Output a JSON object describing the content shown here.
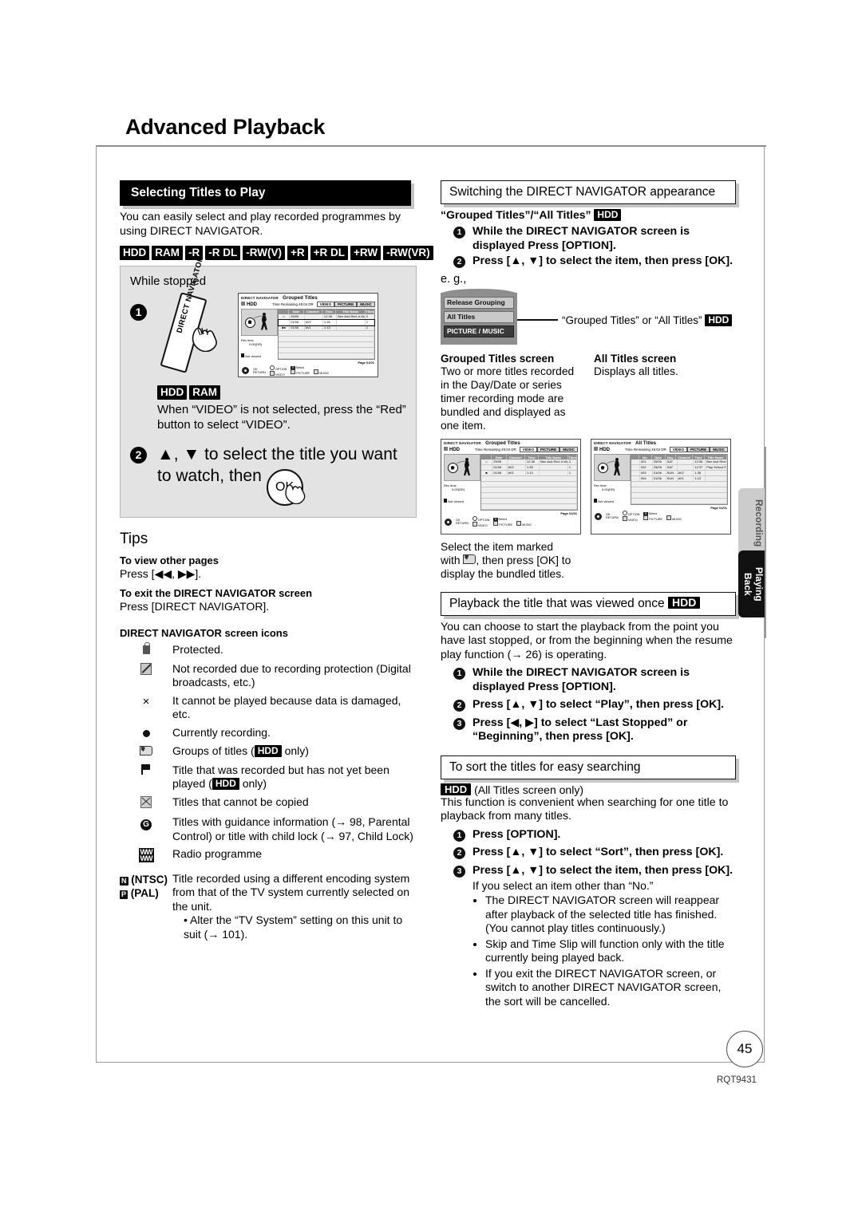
{
  "page": {
    "title": "Advanced Playback",
    "number": "45",
    "doc_id": "RQT9431"
  },
  "side_tabs": [
    {
      "label": "Recording",
      "state": "inactive"
    },
    {
      "label": "Playing Back",
      "state": "active"
    }
  ],
  "left_column": {
    "section_header": "Selecting Titles to Play",
    "intro": "You can easily select and play recorded programmes by using DIRECT NAVIGATOR.",
    "media_badges": [
      "HDD",
      "RAM",
      "-R",
      "-R DL",
      "-RW(V)",
      "+R",
      "+R DL",
      "+RW",
      "-RW(VR)"
    ],
    "while_stopped": "While stopped",
    "step1": {
      "num": "1",
      "button_label": "DIRECT NAVIGATOR"
    },
    "step1_note": {
      "badges": [
        "HDD",
        "RAM"
      ],
      "text": "When “VIDEO” is not selected, press the “Red” button to select “VIDEO”."
    },
    "step2": {
      "num": "2",
      "line1": "▲, ▼ to select the title you want",
      "line2": "to watch, then",
      "ok_label": "OK"
    },
    "tips": {
      "heading": "Tips",
      "items": [
        {
          "title": "To view other pages",
          "text": "Press [◀◀, ▶▶]."
        },
        {
          "title": "To exit the DIRECT NAVIGATOR screen",
          "text": "Press [DIRECT NAVIGATOR]."
        }
      ],
      "icons_heading": "DIRECT NAVIGATOR screen icons",
      "icons": [
        {
          "icon": "lock-icon",
          "text": "Protected."
        },
        {
          "icon": "no-record-icon",
          "text": "Not recorded due to recording protection (Digital broadcasts, etc.)"
        },
        {
          "icon": "cross-icon",
          "text": "It cannot be played because data is damaged, etc."
        },
        {
          "icon": "record-dot-icon",
          "text": "Currently recording."
        },
        {
          "icon": "group-icon",
          "text_before": "Groups of titles (",
          "badge": "HDD",
          "text_after": " only)"
        },
        {
          "icon": "flag-icon",
          "text_before": "Title that was recorded but has not yet been played (",
          "badge": "HDD",
          "text_after": " only)"
        },
        {
          "icon": "no-copy-icon",
          "text": "Titles that cannot be copied"
        },
        {
          "icon": "guidance-g-icon",
          "text": "Titles with guidance information (→ 98, Parental Control) or title with child lock (→ 97, Child Lock)"
        },
        {
          "icon": "radio-icon",
          "text": "Radio programme"
        }
      ],
      "tv_system": {
        "label_ntsc": "(NTSC)",
        "label_pal": "(PAL)",
        "text": "Title recorded using a different encoding system from that of the TV system currently selected on the unit.",
        "bullet": "Alter the “TV System” setting on this unit to suit (→ 101)."
      }
    }
  },
  "right_column": {
    "section1": {
      "header": "Switching the DIRECT NAVIGATOR appearance",
      "subhead_text": "“Grouped Titles”/“All Titles”",
      "subhead_badge": "HDD",
      "steps": [
        {
          "num": "1",
          "text": "While the DIRECT NAVIGATOR screen is displayed Press [OPTION]."
        },
        {
          "num": "2",
          "text": "Press [▲, ▼] to select the item, then press [OK]."
        }
      ],
      "eg_label": "e. g.,",
      "option_menu": [
        "Release Grouping",
        "All Titles",
        "PICTURE / MUSIC"
      ],
      "callout_text": "“Grouped Titles” or “All Titles”",
      "callout_badge": "HDD",
      "compare": [
        {
          "title": "Grouped Titles screen",
          "text": "Two or more titles recorded in the Day/Date or series timer recording mode are bundled and displayed as one item."
        },
        {
          "title": "All Titles screen",
          "text": "Displays all titles."
        }
      ],
      "after_note_1": "Select the item marked",
      "after_note_2": ", then press [OK] to",
      "after_note_3": "display the bundled titles.",
      "after_note_prefix": "with"
    },
    "section2": {
      "header": "Playback the title that was viewed once",
      "header_badge": "HDD",
      "intro": "You can choose to start the playback from the point you have last stopped, or from the beginning when the resume play function (→ 26) is operating.",
      "steps": [
        {
          "num": "1",
          "text": "While the DIRECT NAVIGATOR screen is displayed Press [OPTION]."
        },
        {
          "num": "2",
          "text": "Press [▲, ▼] to select “Play”, then press [OK]."
        },
        {
          "num": "3",
          "text": "Press [◀, ▶] to select “Last Stopped” or “Beginning”, then press [OK]."
        }
      ]
    },
    "section3": {
      "header": "To sort the titles for easy searching",
      "badge": "HDD",
      "badge_note": "(All Titles screen only)",
      "intro": "This function is convenient when searching for one title to playback from many titles.",
      "steps": [
        {
          "num": "1",
          "text": "Press [OPTION]."
        },
        {
          "num": "2",
          "text": "Press [▲, ▼] to select “Sort”, then press [OK]."
        },
        {
          "num": "3",
          "text": "Press [▲, ▼] to select the item, then press [OK]."
        }
      ],
      "sub_note": "If you select an item other than “No.”",
      "bullets": [
        "The DIRECT NAVIGATOR screen will reappear after playback of the selected title has finished. (You cannot play titles continuously.)",
        "Skip and Time Slip will function only with the title currently being played back.",
        "If you exit the DIRECT NAVIGATOR screen, or switch to another DIRECT NAVIGATOR screen, the sort will be cancelled."
      ]
    }
  },
  "tv_screens": {
    "step1_screen": {
      "app": "DIRECT NAVIGATOR",
      "mode": "Grouped Titles",
      "drive": "HDD",
      "remaining": "Time Remaining  45:04 DR",
      "tabs": [
        "VIDEO",
        "PICTURE",
        "MUSIC"
      ],
      "active_tab": "VIDEO",
      "rec_time_label": "Rec time",
      "rec_time_value": "0:00(DR)",
      "not_viewed": "Not viewed",
      "columns": [
        "",
        "Date",
        "Channel",
        "Time",
        "Title Name",
        "Titles"
      ],
      "rows": [
        {
          "icon": "group",
          "date": "25/05",
          "channel": "",
          "time": "12:36",
          "title": "Ben And Red: A Walk a",
          "titles": "2"
        },
        {
          "icon": "",
          "date": "01/06",
          "channel": "AV2",
          "time": "1:35",
          "title": "",
          "titles": "1"
        },
        {
          "icon": "flag-rec",
          "date": "01/06",
          "channel": "AV1",
          "time": "1:13",
          "title": "",
          "titles": "1"
        }
      ],
      "page_label": "Page 01/01",
      "footer": [
        "OK",
        "RETURN",
        "OPTION",
        "VIDEO",
        "Select",
        "PICTURE",
        "MUSIC"
      ]
    },
    "grouped_titles_screen": {
      "app": "DIRECT NAVIGATOR",
      "mode": "Grouped Titles",
      "drive": "HDD",
      "remaining": "Time Remaining  45:04 DR",
      "tabs": [
        "VIDEO",
        "PICTURE",
        "MUSIC"
      ],
      "active_tab": "VIDEO",
      "rec_time_label": "Rec time",
      "rec_time_value": "0:00(DR)",
      "not_viewed": "Not viewed",
      "columns": [
        "",
        "Date",
        "Channel",
        "Time",
        "Title Name",
        "Titles"
      ],
      "rows": [
        {
          "icon": "group",
          "date": "25/05",
          "channel": "",
          "time": "12:36",
          "title": "Ben And Red: A Walk a",
          "titles": "2"
        },
        {
          "icon": "",
          "date": "01/06",
          "channel": "AV2",
          "time": "1:35",
          "title": "",
          "titles": "1"
        },
        {
          "icon": "flag",
          "date": "01/06",
          "channel": "AV1",
          "time": "1:13",
          "title": "",
          "titles": "1"
        }
      ],
      "page_label": "Page 01/01"
    },
    "all_titles_screen": {
      "app": "DIRECT NAVIGATOR",
      "mode": "All Titles",
      "drive": "HDD",
      "remaining": "Time Remaining  45:04 DR",
      "tabs": [
        "VIDEO",
        "PICTURE",
        "MUSIC"
      ],
      "active_tab": "VIDEO",
      "rec_time_label": "Rec time",
      "rec_time_value": "0:00(DR)",
      "not_viewed": "Not viewed",
      "columns": [
        "",
        "No.",
        "Date",
        "Day",
        "Channel",
        "Time",
        "Title Name"
      ],
      "rows": [
        {
          "no": "001",
          "date": "25/05",
          "day": "SAT",
          "channel": "",
          "time": "12:36",
          "title": "Ben And Red: A Walk a"
        },
        {
          "no": "002",
          "date": "25/05",
          "day": "SAT",
          "channel": "",
          "time": "12:37",
          "title": "Play School  Food Friday"
        },
        {
          "no": "003",
          "date": "01/06",
          "day": "SUN",
          "channel": "AV2",
          "time": "1:35",
          "title": ""
        },
        {
          "no": "004",
          "date": "01/06",
          "day": "SUN",
          "channel": "AV1",
          "time": "1:13",
          "title": ""
        }
      ],
      "page_label": "Page 01/01"
    }
  }
}
